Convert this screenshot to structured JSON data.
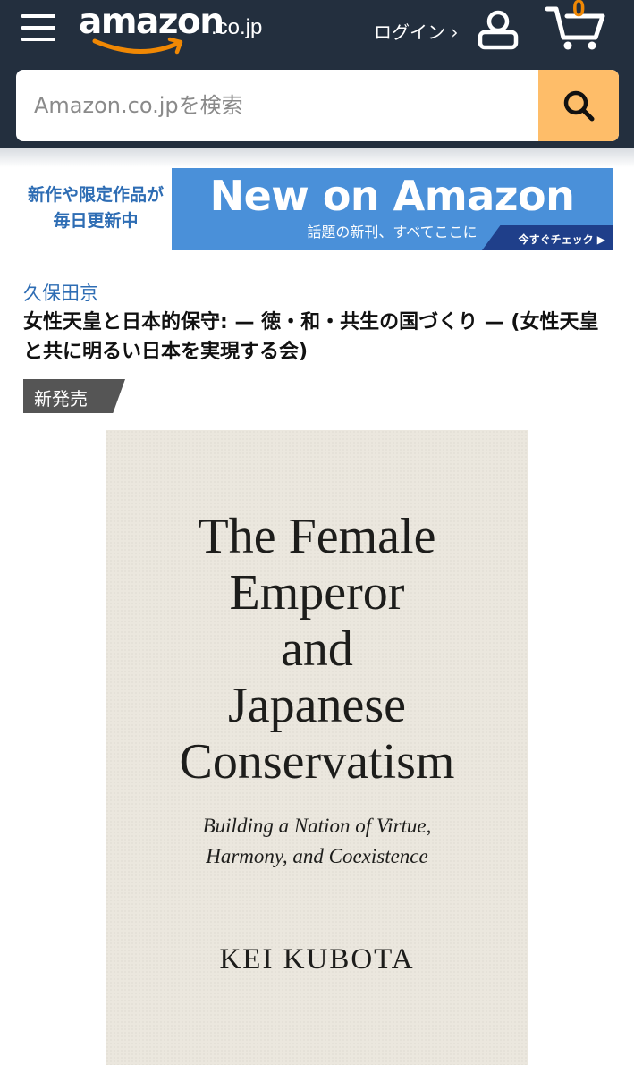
{
  "header": {
    "logo_text": "amazon",
    "logo_tld": ".co.jp",
    "login_label": "ログイン ›",
    "cart_count": "0",
    "search_placeholder": "Amazon.co.jpを検索",
    "colors": {
      "background": "#232f3e",
      "search_button": "#febd69",
      "cart_count": "#f08804"
    },
    "icons": [
      "hamburger-menu-icon",
      "user-icon",
      "cart-icon",
      "search-icon"
    ]
  },
  "banner": {
    "left_text_line1": "新作や限定作品が",
    "left_text_line2": "毎日更新中",
    "title": "New on Amazon",
    "subtitle": "話題の新刊、すべてここに",
    "cta": "今すぐチェック ▶",
    "color": "#4a90d9"
  },
  "product": {
    "author": "久保田京",
    "title": "女性天皇と日本的保守: — 徳・和・共生の国づくり — (女性天皇と共に明るい日本を実現する会)",
    "badge": "新発売"
  },
  "cover": {
    "title_line1": "The Female",
    "title_line2": "Emperor",
    "title_line3": "and",
    "title_line4": "Japanese",
    "title_line5": "Conservatism",
    "subtitle_line1": "Building a Nation of Virtue,",
    "subtitle_line2": "Harmony, and Coexistence",
    "author": "KEI KUBOTA"
  }
}
